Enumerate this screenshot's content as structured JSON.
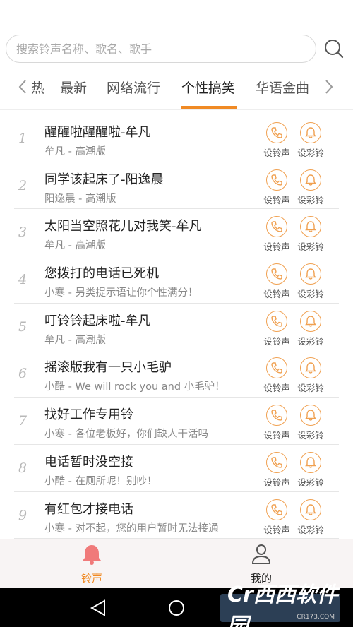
{
  "search": {
    "placeholder": "搜索铃声名称、歌名、歌手"
  },
  "tabs": [
    {
      "label": "热"
    },
    {
      "label": "最新"
    },
    {
      "label": "网络流行"
    },
    {
      "label": "个性搞笑"
    },
    {
      "label": "华语金曲"
    }
  ],
  "active_tab": "个性搞笑",
  "actions": {
    "set_ringtone": "设铃声",
    "set_color_ring": "设彩铃"
  },
  "songs": [
    {
      "index": "1",
      "title": "醒醒啦醒醒啦-牟凡",
      "subtitle": "牟凡 - 高潮版"
    },
    {
      "index": "2",
      "title": "同学该起床了-阳逸晨",
      "subtitle": "阳逸晨 - 高潮版"
    },
    {
      "index": "3",
      "title": "太阳当空照花儿对我笑-牟凡",
      "subtitle": "牟凡 - 高潮版"
    },
    {
      "index": "4",
      "title": "您拨打的电话已死机",
      "subtitle": "小寒 - 另类提示语让你个性满分！"
    },
    {
      "index": "5",
      "title": "叮铃铃起床啦-牟凡",
      "subtitle": "牟凡 - 高潮版"
    },
    {
      "index": "6",
      "title": "摇滚版我有一只小毛驴",
      "subtitle": "小酷 - We will rock you and 小毛驴！"
    },
    {
      "index": "7",
      "title": "找好工作专用铃",
      "subtitle": "小寒 - 各位老板好，你们缺人干活吗"
    },
    {
      "index": "8",
      "title": "电话暂时没空接",
      "subtitle": "小酷 - 在厕所呢！别吵！"
    },
    {
      "index": "9",
      "title": "有红包才接电话",
      "subtitle": "小寒 - 对不起，您的用户暂时无法接通"
    }
  ],
  "bottom_nav": {
    "ringtone": "铃声",
    "mine": "我的"
  },
  "watermark": {
    "logo_text": "Cr西西软件园",
    "site": "CR173.COM"
  },
  "colors": {
    "accent": "#f08a24",
    "icon_ring": "#f0a050"
  }
}
